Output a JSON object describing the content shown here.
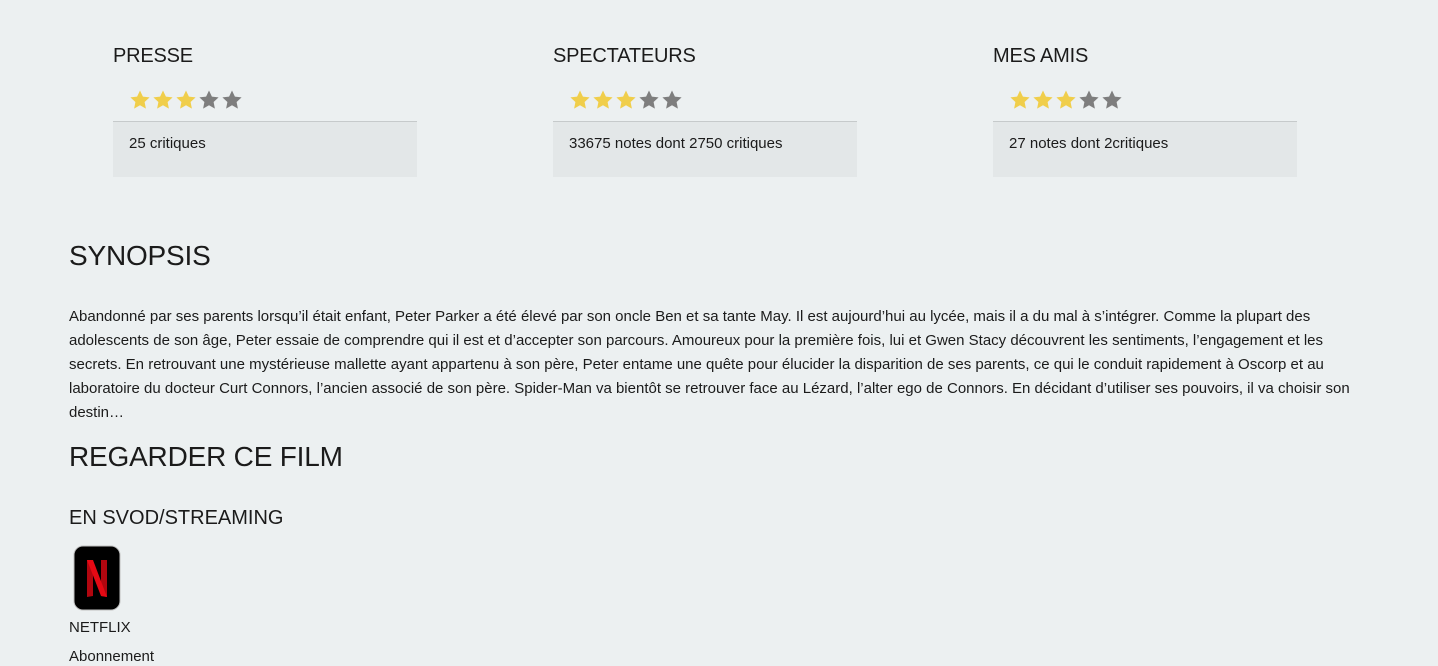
{
  "ratings": [
    {
      "title": "PRESSE",
      "stars": 3,
      "max_stars": 5,
      "summary": "25 critiques"
    },
    {
      "title": "SPECTATEURS",
      "stars": 3,
      "max_stars": 5,
      "summary": "33675 notes dont 2750 critiques"
    },
    {
      "title": "MES AMIS",
      "stars": 3,
      "max_stars": 5,
      "summary": "27 notes dont 2critiques"
    }
  ],
  "colors": {
    "background": "#ecf0f1",
    "card_background": "#e3e7e8",
    "star_filled": "#f0ce4b",
    "star_empty": "#7e7e7e",
    "netflix_red": "#e50914"
  },
  "synopsis": {
    "title": "SYNOPSIS",
    "text": "Abandonné par ses parents lorsqu’il était enfant, Peter Parker a été élevé par son oncle Ben et sa tante May. Il est aujourd’hui au lycée, mais il a du mal à s’intégrer. Comme la plupart des adolescents de son âge, Peter essaie de comprendre qui il est et d’accepter son parcours. Amoureux pour la première fois, lui et Gwen Stacy découvrent les sentiments, l’engagement et les secrets. En retrouvant une mystérieuse mallette ayant appartenu à son père, Peter entame une quête pour élucider la disparition de ses parents, ce qui le conduit rapidement à Oscorp et au laboratoire du docteur Curt Connors, l’ancien associé de son père. Spider-Man va bientôt se retrouver face au Lézard, l’alter ego de Connors. En décidant d’utiliser ses pouvoirs, il va choisir son destin…"
  },
  "watch": {
    "title": "REGARDER CE FILM",
    "svod_title": "EN SVOD/STREAMING",
    "providers": [
      {
        "name": "NETFLIX",
        "type": "Abonnement",
        "icon": "netflix-logo-icon"
      }
    ]
  }
}
